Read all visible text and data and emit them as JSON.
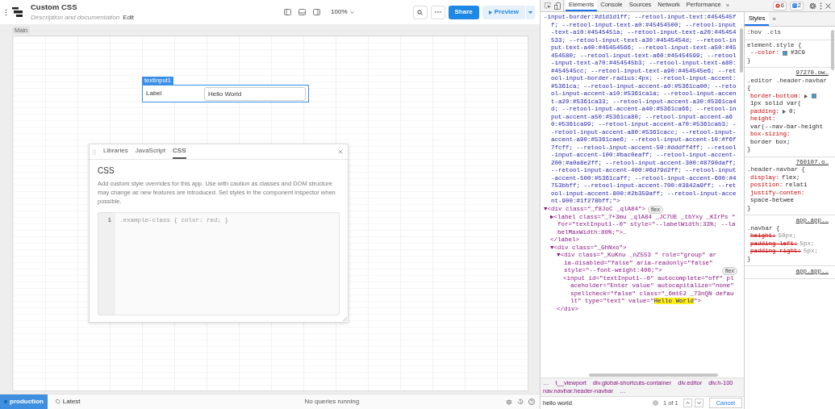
{
  "app_header": {
    "title": "Custom CSS",
    "description": "Description and documentation",
    "edit_link": "Edit",
    "zoom": "100%",
    "share_button": "Share",
    "preview_button": "Preview"
  },
  "canvas": {
    "frame_label": "Main",
    "component": {
      "name_tag": "textInput1",
      "label": "Label",
      "value": "Hello World",
      "selected": true
    }
  },
  "code_panel": {
    "tabs": [
      {
        "label": "Libraries",
        "selected": false
      },
      {
        "label": "JavaScript",
        "selected": false
      },
      {
        "label": "CSS",
        "selected": true
      }
    ],
    "heading": "CSS",
    "description": "Add custom style overrides for this app. Use with caution as classes and DOM structure may change as new features are introduced. Set styles in the component inspector when possible.",
    "line_numbers": [
      "1"
    ],
    "placeholder": ".example-class { color: red; }"
  },
  "status_bar": {
    "environment": "production",
    "version": "Latest",
    "queries": "No queries running"
  },
  "devtools": {
    "tabs": [
      {
        "label": "Elements",
        "selected": true
      },
      {
        "label": "Console",
        "selected": false
      },
      {
        "label": "Sources",
        "selected": false
      },
      {
        "label": "Network",
        "selected": false
      },
      {
        "label": "Performance",
        "selected": false
      }
    ],
    "overflow": "»",
    "error_count": "6",
    "message_count": "2",
    "dom_tree": [
      {
        "kind": "attributes",
        "text": "-input-border:#d1d1d1ff; --retool-input-text:#454545ff; --retool-input-text-a0:#45454500; --retool-input-text-a10:#4545451a; --retool-input-text-a20:#45454533; --retool-input-text-a30:#4545454d; --retool-input-text-a40:#45454566; --retool-input-text-a50:#45454580; --retool-input-text-a60:#45454599; --retool-input-text-a70:#454545b3; --retool-input-text-a80:#454545cc; --retool-input-text-a90:#454545e6; --retool-input-border-radius:4px; --retool-input-accent:#5361ca; --retool-input-accent-a0:#5361ca00; --retool-input-accent-a10:#5361ca1a; --retool-input-accent-a20:#5361ca33; --retool-input-accent-a30:#5361ca4d; --retool-input-accent-a40:#5361ca66; --retool-input-accent-a50:#5361ca80; --retool-input-accent-a60:#5361ca99; --retool-input-accent-a70:#5361cab3; --retool-input-accent-a80:#5361cacc; --retool-input-accent-a90:#5361cae6; --retool-input-accent-10:#f6f7fcff; --retool-input-accent-50:#dddff4ff; --retool-input-accent-100:#bac0eaff; --retool-input-accent-200:#a0a8e2ff; --retool-input-accent-300:#8790daff; --retool-input-accent-400:#6d79d2ff; --retool-input-accent-500:#5361caff; --retool-input-accent-600:#4753bbff; --retool-input-accent-700:#3842a9ff; --retool-input-accent-800:#2b359aff; --retool-input-accent-900:#1f278bff;\">"
      },
      {
        "kind": "element",
        "text": "▼<div class=\"_f8JoC _qlA84\">",
        "badge": "flex",
        "children": [
          {
            "kind": "element",
            "text": "▶<label class=\"_7+3mu _qlA84 _JC7UE _tbYxy _KIrPs \" for=\"textInput1--0\" style=\"--labelWidth:33%; --labelMaxWidth:80%;\">…",
            "closing": "</label>"
          },
          {
            "kind": "element",
            "text": "▼<div class=\"_GhNxo\">",
            "children": [
              {
                "kind": "element",
                "text": "▼<div class=\"_KuKnu _nZ553 \" role=\"group\" aria-disabled=\"false\" aria-readonly=\"false\" style=\"--font-weight:400;\">",
                "badge": "flex",
                "children": [
                  {
                    "kind": "element",
                    "text": "<input id=\"textInput1--0\" autocomplete=\"off\" placeholder=\"Enter value\" autocapitalize=\"none\" spellcheck=\"false\" class=\"_6mtE2 _73nQN default\" type=\"text\" value=\"**Hello World**\">"
                  }
                ],
                "closing": "</div>"
              }
            ]
          }
        ]
      }
    ],
    "breadcrumbs": [
      "…",
      "t__viewport",
      "div.global-shortcuts-container",
      "div.editor",
      "div.h-100",
      "nav.navbar.header-navbar",
      "…"
    ],
    "search": {
      "value": "hello world",
      "match_count": "1 of 1",
      "cancel": "Cancel"
    },
    "styles_pane": {
      "tabs": [
        {
          "label": "Styles",
          "selected": true
        }
      ],
      "overflow": "»",
      "filters": [
        ":hov",
        ".cls"
      ],
      "rules": [
        {
          "selector": "element.style {",
          "declarations": [
            {
              "property": "--color:",
              "value": "#3C9",
              "swatch": true
            }
          ],
          "closing": "}"
        },
        {
          "source": "97270.ow…",
          "selector": ".editor .header-navbar {",
          "declarations": [
            {
              "property": "border-bottom:",
              "value": "1px solid var(",
              "expandable": true,
              "swatch": true
            },
            {
              "property": "padding:",
              "value": "0;",
              "expandable": true
            },
            {
              "property": "height:",
              "value": "var(--nav-bar-height"
            },
            {
              "property": "box-sizing:",
              "value": "border box;"
            }
          ],
          "closing": "}"
        },
        {
          "source": "760107.o…",
          "selector": ".header-navbar {",
          "declarations": [
            {
              "property": "display:",
              "value": "flex;"
            },
            {
              "property": "position:",
              "value": "relati"
            },
            {
              "property": "justify-conten:",
              "value": "space-betwee"
            }
          ],
          "closing": "}"
        },
        {
          "source": "app.app.…",
          "selector": ".navbar {",
          "declarations": [
            {
              "property": "height:",
              "value": "50px;",
              "overridden": true
            },
            {
              "property": "padding-left:",
              "value": "5px;",
              "overridden": true
            },
            {
              "property": "padding-right:",
              "value": "5px;",
              "overridden": true
            }
          ],
          "closing": "}"
        },
        {
          "source": "app.app.…"
        }
      ]
    }
  }
}
